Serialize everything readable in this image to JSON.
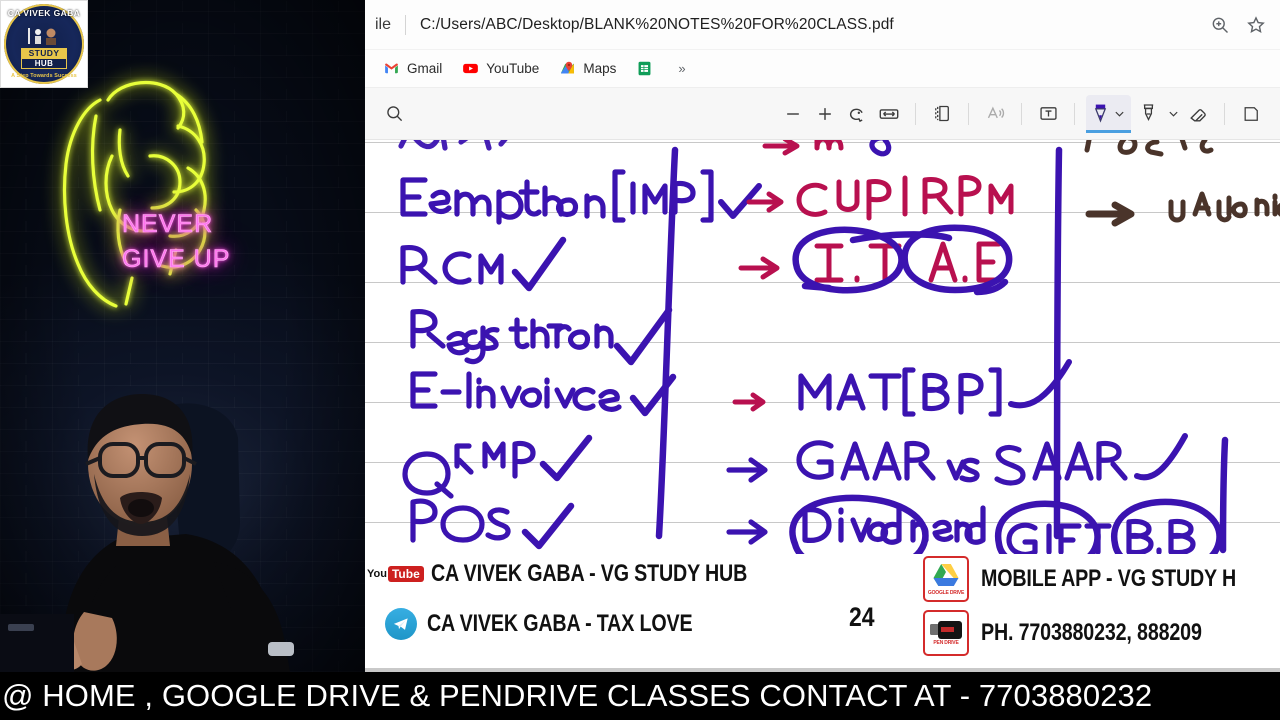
{
  "webcam": {
    "logo": {
      "top_text": "CA VIVEK GABA",
      "study": "STUDY",
      "hub": "HUB",
      "tagline": "A Step Towards Success",
      "icon": "study-hub-logo"
    },
    "neon_sign": {
      "line1": "NEVER",
      "line2": "GIVE UP",
      "text_color": "#ff74ee",
      "fist_color": "#e8ff3a",
      "wall_color": "#0b1121"
    },
    "presenter": "presenter-video-feed"
  },
  "browser": {
    "address": {
      "file_label": "ile",
      "url": "C:/Users/ABC/Desktop/BLANK%20NOTES%20FOR%20CLASS.pdf",
      "zoom_icon": "zoom-in-icon",
      "favorite_icon": "star-icon"
    },
    "bookmarks": [
      {
        "label": "Gmail",
        "icon": "gmail-icon"
      },
      {
        "label": "YouTube",
        "icon": "youtube-icon"
      },
      {
        "label": "Maps",
        "icon": "google-maps-icon"
      },
      {
        "label": "",
        "icon": "google-sheets-icon"
      }
    ],
    "bookmarks_overflow": "»"
  },
  "pdf_toolbar": {
    "search_icon": "search-icon",
    "zoom_out_icon": "minus-icon",
    "zoom_in_icon": "plus-icon",
    "rotate_icon": "rotate-icon",
    "fit_width_icon": "fit-to-width-icon",
    "page_view_icon": "page-layout-icon",
    "read_aloud_icon": "read-aloud-icon",
    "text_tool_icon": "add-text-icon",
    "draw_tool_icon": "pen-icon",
    "draw_tool_chevron_icon": "chevron-down-icon",
    "highlight_tool_icon": "highlighter-icon",
    "highlight_chevron_icon": "chevron-down-icon",
    "erase_tool_icon": "eraser-icon",
    "save_icon": "save-icon",
    "active_tool": "pen-icon",
    "active_tool_accent": "#4a9fe0"
  },
  "pdf_page": {
    "page_number": "24",
    "ink_colors": {
      "blue": "#3b13b0",
      "crimson": "#b8104f",
      "brown": "#4a342a"
    },
    "left_column": [
      {
        "text": "Exemption [IMP]",
        "tick": true
      },
      {
        "text": "RCM",
        "tick": true
      },
      {
        "text": "Registration",
        "tick": true
      },
      {
        "text": "E-Invoice",
        "tick": true
      },
      {
        "text": "QRMP",
        "tick": true
      },
      {
        "text": "POS",
        "tick": true
      }
    ],
    "middle_column": [
      {
        "arrow": true,
        "text": "CUP | RPM",
        "circled": false
      },
      {
        "arrow": true,
        "text": "I.T",
        "circled": true
      },
      {
        "arrow": false,
        "text": "A.E",
        "circled": true
      },
      {
        "arrow": true,
        "text": "MAT [BP]",
        "circled": false
      },
      {
        "arrow": true,
        "text": "GAAR vs SAAR",
        "circled": false
      },
      {
        "arrow": true,
        "text": "Dividend",
        "circled": true
      },
      {
        "arrow": false,
        "text": "GIFT",
        "circled": true
      },
      {
        "arrow": false,
        "text": "B.B",
        "circled": true
      }
    ],
    "right_column": [
      {
        "arrow": true,
        "text": "Valuation"
      }
    ]
  },
  "promo": {
    "youtube_prefix_you": "You",
    "youtube_prefix_tube": "Tube",
    "youtube_channel": "CA VIVEK GABA - VG STUDY HUB",
    "telegram_channel": "CA VIVEK GABA - TAX LOVE",
    "mobile_app": "MOBILE APP - VG STUDY H",
    "phone": "PH. 7703880232, 888209",
    "google_drive_caption": "GOOGLE DRIVE",
    "pen_drive_caption": "PEN DRIVE",
    "telegram_icon": "telegram-icon",
    "drive_icon": "google-drive-icon",
    "pendrive_icon": "pen-drive-icon"
  },
  "ticker": {
    "text": "@ HOME , GOOGLE DRIVE & PENDRIVE CLASSES CONTACT AT - 7703880232",
    "background": "#000000",
    "color": "#ffffff"
  }
}
